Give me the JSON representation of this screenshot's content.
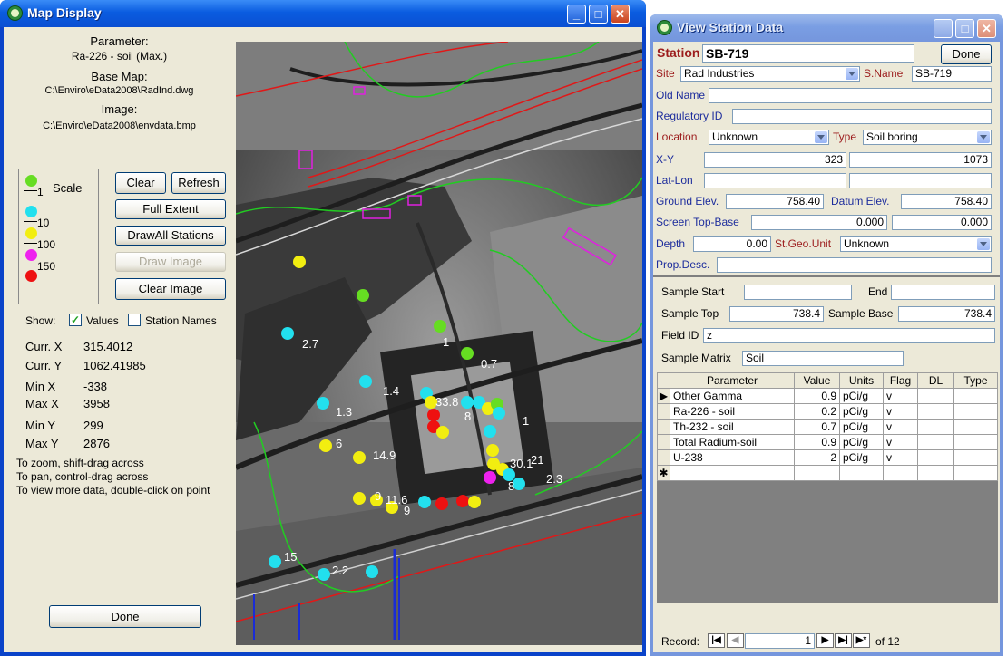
{
  "map_window": {
    "title": "Map Display",
    "parameter_label": "Parameter:",
    "parameter_value": "Ra-226 - soil (Max.)",
    "base_map_label": "Base Map:",
    "base_map_value": "C:\\Enviro\\eData2008\\RadInd.dwg",
    "image_label": "Image:",
    "image_value": "C:\\Enviro\\eData2008\\envdata.bmp",
    "scale_title": "Scale",
    "scale_items": [
      {
        "label": "1",
        "color": "#66dd22"
      },
      {
        "label": "10",
        "color": "#22e0ee"
      },
      {
        "label": "100",
        "color": "#f2ee10"
      },
      {
        "label": "150",
        "color": "#ee22ee"
      },
      {
        "label": "",
        "color": "#ee1111"
      }
    ],
    "buttons": {
      "clear": "Clear",
      "refresh": "Refresh",
      "full_extent": "Full Extent",
      "draw_all_stations": "DrawAll Stations",
      "draw_image": "Draw Image",
      "clear_image": "Clear Image",
      "done": "Done"
    },
    "show_label": "Show:",
    "show_values_label": "Values",
    "show_values_checked": true,
    "show_station_names_label": "Station Names",
    "show_station_names_checked": false,
    "coords": {
      "curr_x_label": "Curr. X",
      "curr_x": "315.4012",
      "curr_y_label": "Curr. Y",
      "curr_y": "1062.41985",
      "min_x_label": "Min X",
      "min_x": "-338",
      "max_x_label": "Max X",
      "max_x": "3958",
      "min_y_label": "Min Y",
      "min_y": "299",
      "max_y_label": "Max Y",
      "max_y": "2876"
    },
    "help": [
      "To zoom, shift-drag across",
      "To pan, control-drag across",
      "To view more data, double-click on point"
    ],
    "map_labels": [
      "2.7",
      "1",
      "0.7",
      "1.4",
      "1.3",
      "33.8",
      "1",
      "6",
      "14.9",
      "30.1",
      "21",
      "8",
      "2.3",
      "9",
      "11.6",
      "9",
      "15",
      "2.2",
      "8"
    ]
  },
  "station_window": {
    "title": "View Station Data",
    "station_label": "Station",
    "station_value": "SB-719",
    "done_label": "Done",
    "site_label": "Site",
    "site_value": "Rad Industries",
    "sname_label": "S.Name",
    "sname_value": "SB-719",
    "old_name_label": "Old Name",
    "old_name_value": "",
    "regulatory_id_label": "Regulatory ID",
    "regulatory_id_value": "",
    "location_label": "Location",
    "location_value": "Unknown",
    "type_label": "Type",
    "type_value": "Soil boring",
    "xy_label": "X-Y",
    "x_value": "323",
    "y_value": "1073",
    "latlon_label": "Lat-Lon",
    "lat_value": "",
    "lon_value": "",
    "ground_elev_label": "Ground Elev.",
    "ground_elev_value": "758.40",
    "datum_elev_label": "Datum Elev.",
    "datum_elev_value": "758.40",
    "screen_label": "Screen Top-Base",
    "screen_top_value": "0.000",
    "screen_base_value": "0.000",
    "depth_label": "Depth",
    "depth_value": "0.00",
    "stgeo_label": "St.Geo.Unit",
    "stgeo_value": "Unknown",
    "propdesc_label": "Prop.Desc.",
    "propdesc_value": "",
    "sample_start_label": "Sample Start",
    "sample_start_value": "",
    "end_label": "End",
    "end_value": "",
    "sample_top_label": "Sample Top",
    "sample_top_value": "738.4",
    "sample_base_label": "Sample Base",
    "sample_base_value": "738.4",
    "field_id_label": "Field ID",
    "field_id_value": "z",
    "sample_matrix_label": "Sample Matrix",
    "sample_matrix_value": "Soil",
    "grid_headers": [
      "Parameter",
      "Value",
      "Units",
      "Flag",
      "DL",
      "Type"
    ],
    "grid_rows": [
      [
        "Other Gamma",
        "0.9",
        "pCi/g",
        "v",
        "",
        ""
      ],
      [
        "Ra-226 - soil",
        "0.2",
        "pCi/g",
        "v",
        "",
        ""
      ],
      [
        "Th-232 - soil",
        "0.7",
        "pCi/g",
        "v",
        "",
        ""
      ],
      [
        "Total Radium-soil",
        "0.9",
        "pCi/g",
        "v",
        "",
        ""
      ],
      [
        "U-238",
        "2",
        "pCi/g",
        "v",
        "",
        ""
      ]
    ],
    "record_label": "Record:",
    "record_value": "1",
    "record_of": "of 12"
  }
}
